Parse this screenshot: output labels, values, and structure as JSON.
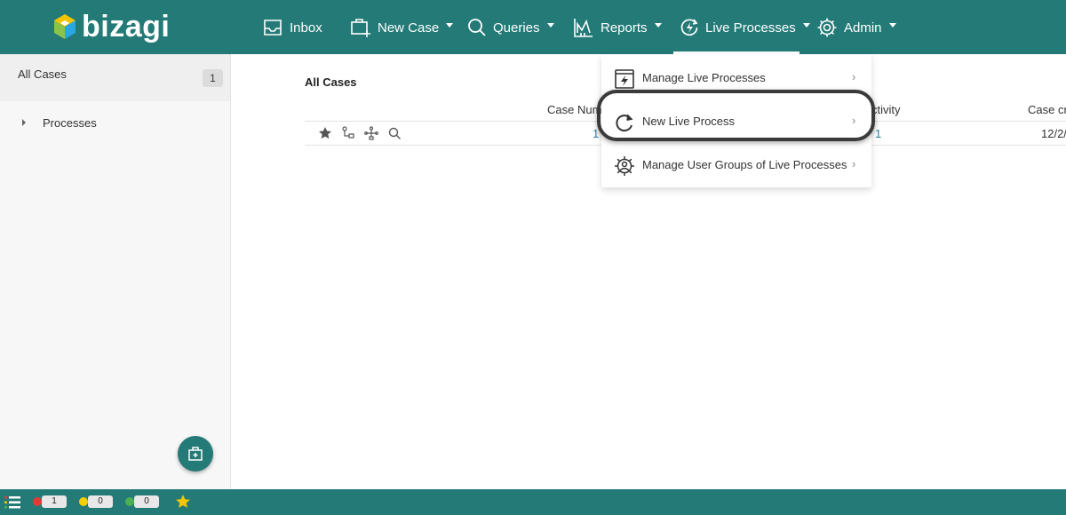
{
  "brand": {
    "name": "bizagi"
  },
  "nav": {
    "inbox": "Inbox",
    "new_case": "New Case",
    "queries": "Queries",
    "reports": "Reports",
    "live_processes": "Live Processes",
    "admin": "Admin"
  },
  "sidebar": {
    "all_cases": {
      "label": "All Cases",
      "count": "1"
    },
    "tree": [
      {
        "label": "Processes"
      }
    ]
  },
  "main": {
    "title": "All Cases",
    "columns": [
      "Case Num",
      "ctivity",
      "Case cre"
    ],
    "rows": [
      {
        "case_number": "1",
        "activity": "1",
        "created": "12/2/"
      }
    ]
  },
  "dropdown": {
    "items": [
      {
        "label": "Manage Live Processes",
        "icon": "lightning-box-icon"
      },
      {
        "label": "New Live Process",
        "icon": "refresh-icon"
      },
      {
        "label": "Manage User Groups of Live Processes",
        "icon": "user-gear-icon"
      }
    ]
  },
  "statusbar": {
    "red": "1",
    "yellow": "0",
    "green": "0"
  },
  "colors": {
    "brand_teal": "#237a77",
    "logo_green": "#8bc34a",
    "logo_blue": "#29a8e0",
    "logo_yellow": "#f5c400",
    "link_blue": "#2a7fa8",
    "star_yellow": "#f2c700"
  }
}
